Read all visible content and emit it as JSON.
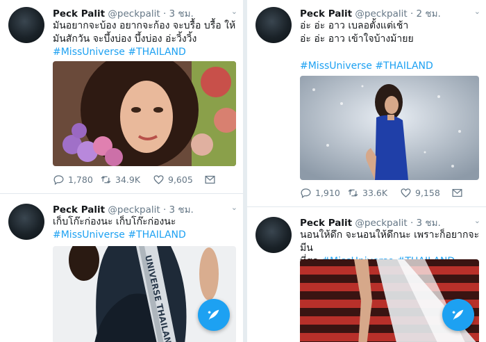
{
  "tweets": [
    {
      "name": "Peck Palit",
      "handle": "@peckpalit",
      "dot": "·",
      "time": "3 ชม.",
      "text_line1": "มันอยากจะบ้อง อยากจะก้อง จะบรื้อ บรื้อ ให้",
      "text_line2": "มันสักวัน จะบึ้งบ่อง บึ้งบ่อง อ่ะวิ้งวิ้ง",
      "hashtag1": "#MissUniverse",
      "hashtag2": "#THAILAND",
      "replies": "1,780",
      "retweets": "34.9K",
      "likes": "9,605"
    },
    {
      "name": "Peck Palit",
      "handle": "@peckpalit",
      "dot": "·",
      "time": "2 ชม.",
      "text_line1": "อ่ะ อ่ะ อาว เบลอตั้งแต่เช้า",
      "text_line2": "อ่ะ อ่ะ อาว เข้าใจบ้างม้ายย",
      "hashtag1": "#MissUniverse",
      "hashtag2": "#THAILAND",
      "replies": "1,910",
      "retweets": "33.6K",
      "likes": "9,158"
    },
    {
      "name": "Peck Palit",
      "handle": "@peckpalit",
      "dot": "·",
      "time": "3 ชม.",
      "text_line1": "เก็บโก๊ะก่องนะ เก็บโก๊ะก่องนะ",
      "hashtag1": "#MissUniverse",
      "hashtag2": "#THAILAND",
      "sash_text": "UNIVERSE THAILAND"
    },
    {
      "name": "Peck Palit",
      "handle": "@peckpalit",
      "dot": "·",
      "time": "3 ชม.",
      "text_line1": "นอนให้ดึก จะนอนให้ดึกนะ เพราะก็อยากจะมีน",
      "text_line2": "ที่สุด",
      "hashtag1": "#MissUniverse",
      "hashtag2": "#THAILAND"
    }
  ],
  "icons": {
    "reply": "reply-icon",
    "retweet": "retweet-icon",
    "like": "heart-icon",
    "dm": "envelope-icon",
    "compose": "compose-tweet-icon",
    "caret": "chevron-down-icon"
  },
  "colors": {
    "accent": "#1da1f2",
    "text": "#14171a",
    "muted": "#657786",
    "border": "#e1e8ed"
  }
}
